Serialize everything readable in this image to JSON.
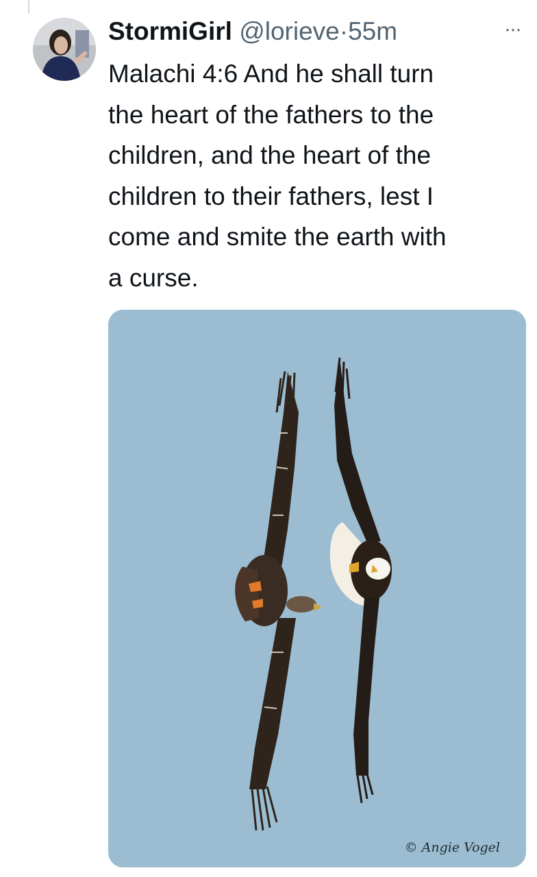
{
  "tweet": {
    "display_name": "StormiGirl",
    "handle": "@lorieve",
    "separator": "·",
    "time": "55m",
    "more_label": "···",
    "text": "Malachi 4:6 And he shall turn\nthe heart of the fathers to the\nchildren, and the heart of the\nchildren to their fathers, lest I\ncome and smite the earth with\na curse."
  },
  "media": {
    "credit": "© Angie Vogel",
    "sky_color": "#9cbdd1",
    "subject": [
      "eagle",
      "eagle"
    ]
  },
  "icons": {
    "avatar": "profile-photo",
    "more": "more-horizontal-icon"
  }
}
